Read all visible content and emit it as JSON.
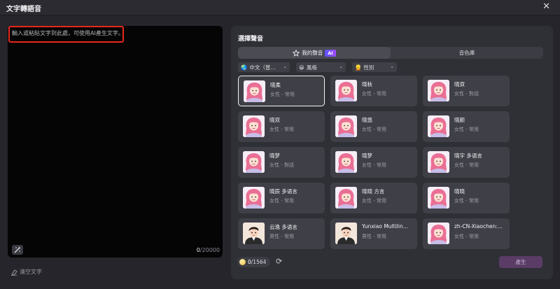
{
  "window": {
    "title": "文字轉語音",
    "close_symbol": "✕"
  },
  "editor": {
    "placeholder": "輸入或粘貼文字到此處，可使用AI產生文字。",
    "count_current": "0",
    "count_max": "/20000"
  },
  "clear_label": "清空文字",
  "panel": {
    "title": "選擇聲音",
    "tabs": [
      {
        "label": "我的聲音",
        "badge": "AI",
        "active": true
      },
      {
        "label": "音色庫",
        "active": false
      }
    ],
    "filters": [
      {
        "label": "中文（普...",
        "icon": "globe-icon"
      },
      {
        "label": "風格",
        "icon": "emoji-icon"
      },
      {
        "label": "性別",
        "icon": "person-icon"
      }
    ],
    "voices": [
      {
        "name": "晓柔",
        "meta": "女性 - 常用",
        "avatar": "female",
        "selected": true
      },
      {
        "name": "晓秋",
        "meta": "女性 - 常用",
        "avatar": "female"
      },
      {
        "name": "晓双",
        "meta": "女性 - 對話",
        "avatar": "female"
      },
      {
        "name": "晓双",
        "meta": "女性 - 常用",
        "avatar": "female"
      },
      {
        "name": "晓悠",
        "meta": "女性 - 常用",
        "avatar": "female"
      },
      {
        "name": "晓颜",
        "meta": "女性 - 常用",
        "avatar": "female"
      },
      {
        "name": "晓梦",
        "meta": "女性 - 對話",
        "avatar": "female"
      },
      {
        "name": "晓梦",
        "meta": "女性 - 常用",
        "avatar": "female"
      },
      {
        "name": "晓宇 多语言",
        "meta": "女性 - 常用",
        "avatar": "female"
      },
      {
        "name": "晓辰 多语言",
        "meta": "女性 - 常用",
        "avatar": "female"
      },
      {
        "name": "晓晓 方言",
        "meta": "女性 - 常用",
        "avatar": "female"
      },
      {
        "name": "晓晓",
        "meta": "女性 - 常用",
        "avatar": "female"
      },
      {
        "name": "云逸 多语言",
        "meta": "男性 - 常用",
        "avatar": "male"
      },
      {
        "name": "Yunxiao Multilin...",
        "meta": "男性 - 常用",
        "avatar": "male"
      },
      {
        "name": "zh-CN-Xiaochen:...",
        "meta": "女性 - 常用",
        "avatar": "female"
      }
    ]
  },
  "credits": {
    "current": "0",
    "total": "/1564"
  },
  "produce_label": "產生",
  "colors": {
    "accent": "#5a3c66",
    "highlight": "#e5281c",
    "ai_badge": "#6a50ff"
  }
}
